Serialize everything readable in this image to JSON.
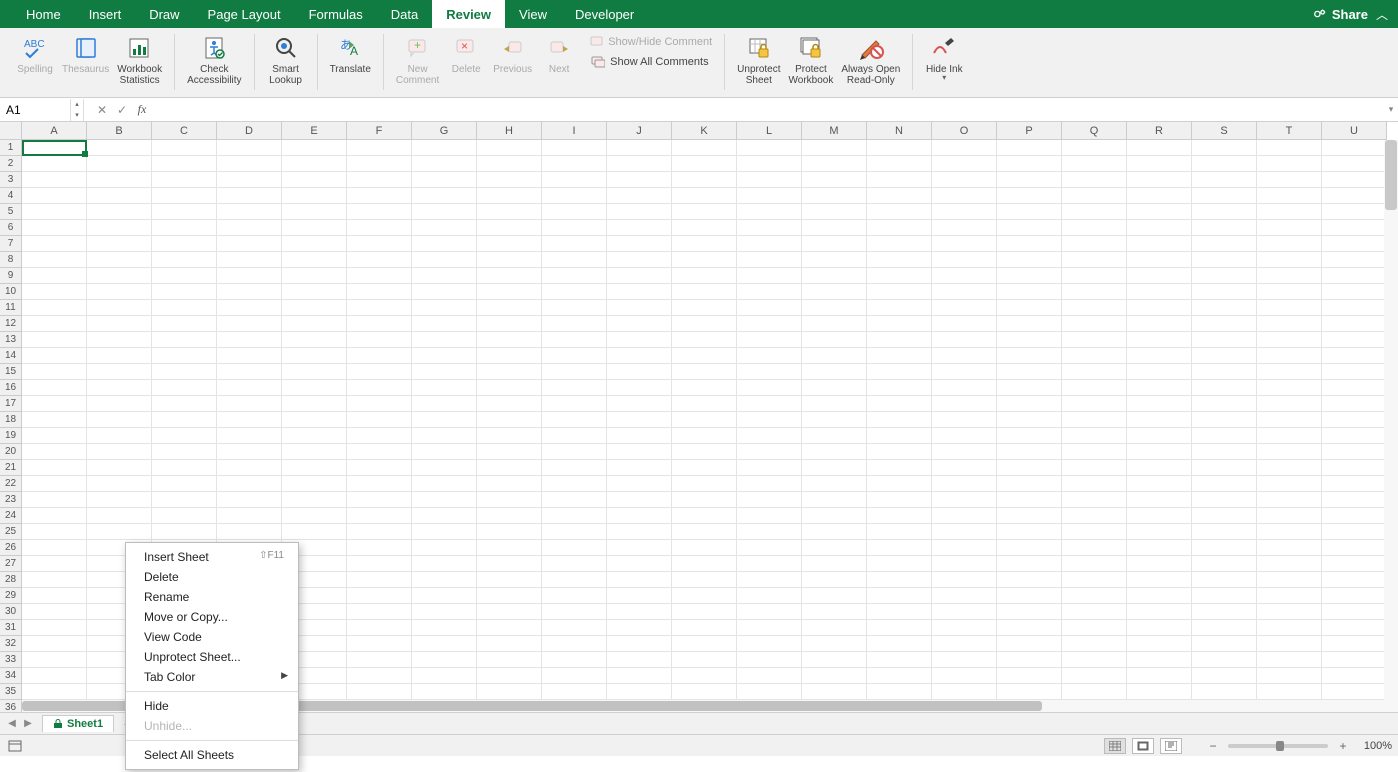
{
  "tabs": [
    "Home",
    "Insert",
    "Draw",
    "Page Layout",
    "Formulas",
    "Data",
    "Review",
    "View",
    "Developer"
  ],
  "active_tab": "Review",
  "share_label": "Share",
  "ribbon": {
    "spelling": "Spelling",
    "thesaurus": "Thesaurus",
    "workbook_stats": "Workbook\nStatistics",
    "check_access": "Check\nAccessibility",
    "smart_lookup": "Smart\nLookup",
    "translate": "Translate",
    "new_comment": "New\nComment",
    "delete": "Delete",
    "previous": "Previous",
    "next": "Next",
    "show_hide": "Show/Hide Comment",
    "show_all": "Show All Comments",
    "unprotect_sheet": "Unprotect\nSheet",
    "protect_workbook": "Protect\nWorkbook",
    "always_open_ro": "Always Open\nRead-Only",
    "hide_ink": "Hide Ink"
  },
  "name_box": "A1",
  "formula_value": "",
  "columns": [
    "A",
    "B",
    "C",
    "D",
    "E",
    "F",
    "G",
    "H",
    "I",
    "J",
    "K",
    "L",
    "M",
    "N",
    "O",
    "P",
    "Q",
    "R",
    "S",
    "T",
    "U"
  ],
  "row_count": 36,
  "sheet_name": "Sheet1",
  "zoom": "100%",
  "context_menu": {
    "insert_sheet": "Insert Sheet",
    "insert_shortcut": "⇧F11",
    "delete": "Delete",
    "rename": "Rename",
    "move_copy": "Move or Copy...",
    "view_code": "View Code",
    "unprotect": "Unprotect Sheet...",
    "tab_color": "Tab Color",
    "hide": "Hide",
    "unhide": "Unhide...",
    "select_all": "Select All Sheets"
  }
}
